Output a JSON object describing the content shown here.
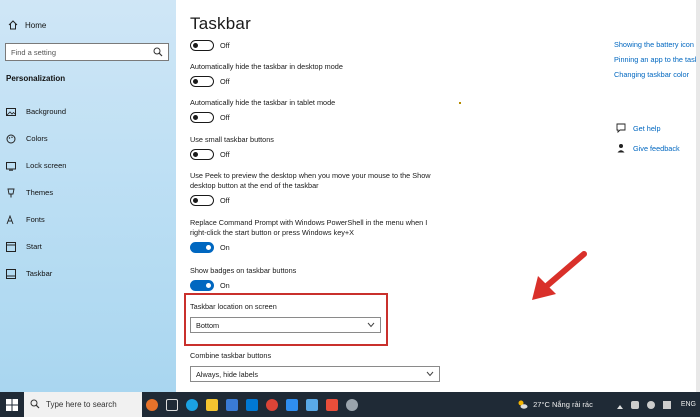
{
  "sidebar": {
    "home_label": "Home",
    "search_placeholder": "Find a setting",
    "section_title": "Personalization",
    "items": [
      {
        "label": "Background",
        "icon": "image-icon"
      },
      {
        "label": "Colors",
        "icon": "palette-icon"
      },
      {
        "label": "Lock screen",
        "icon": "lock-screen-icon"
      },
      {
        "label": "Themes",
        "icon": "themes-icon"
      },
      {
        "label": "Fonts",
        "icon": "fonts-icon"
      },
      {
        "label": "Start",
        "icon": "start-icon"
      },
      {
        "label": "Taskbar",
        "icon": "taskbar-icon"
      }
    ]
  },
  "main": {
    "title": "Taskbar",
    "settings": [
      {
        "label": "",
        "state": "Off",
        "on": false
      },
      {
        "label": "Automatically hide the taskbar in desktop mode",
        "state": "Off",
        "on": false
      },
      {
        "label": "Automatically hide the taskbar in tablet mode",
        "state": "Off",
        "on": false
      },
      {
        "label": "Use small taskbar buttons",
        "state": "Off",
        "on": false
      },
      {
        "label": "Use Peek to preview the desktop when you move your mouse to the Show desktop button at the end of the taskbar",
        "state": "Off",
        "on": false
      },
      {
        "label": "Replace Command Prompt with Windows PowerShell in the menu when I right-click the start button or press Windows key+X",
        "state": "On",
        "on": true
      },
      {
        "label": "Show badges on taskbar buttons",
        "state": "On",
        "on": true
      }
    ],
    "location": {
      "label": "Taskbar location on screen",
      "value": "Bottom"
    },
    "combine": {
      "label": "Combine taskbar buttons",
      "value": "Always, hide labels"
    }
  },
  "related": {
    "links": [
      "Showing the battery icon on the taskbar",
      "Pinning an app to the taskbar",
      "Changing taskbar color"
    ]
  },
  "help": {
    "get_help": "Get help",
    "feedback": "Give feedback"
  },
  "taskbar": {
    "search_text": "Type here to search",
    "weather": "27°C  Nắng rải rác",
    "language": "ENG"
  },
  "colors": {
    "accent": "#0067c0",
    "highlight": "#c9302c",
    "arrow": "#d9302a",
    "taskbar_bg": "#1f2a36"
  }
}
